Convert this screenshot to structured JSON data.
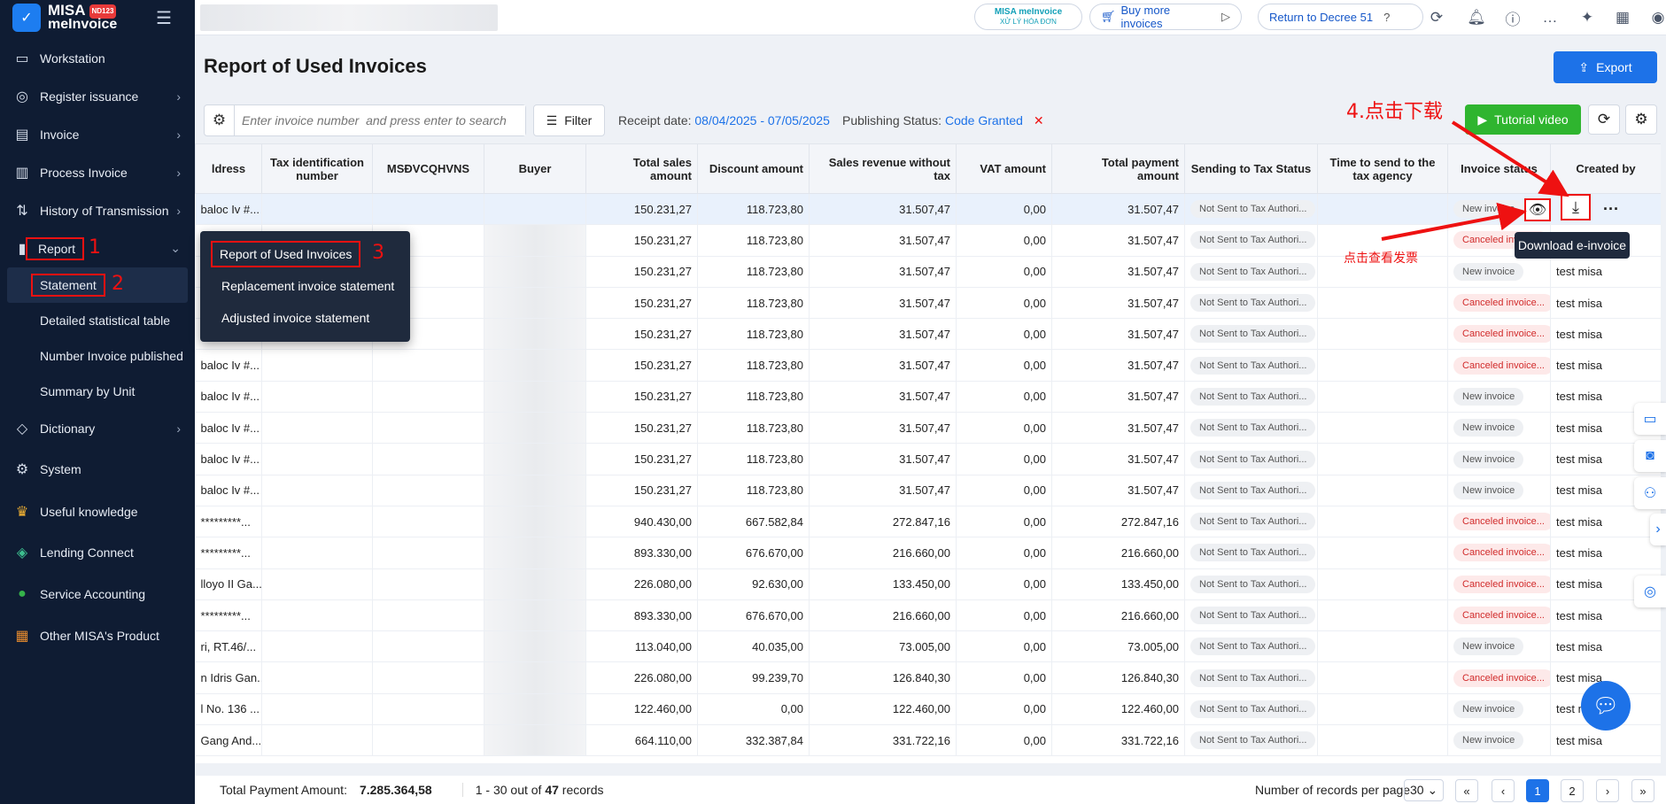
{
  "brand": {
    "name_line1": "MISA",
    "name_line2": "meInvoice",
    "badge": "ND123"
  },
  "sidebar": {
    "items": [
      {
        "label": "Workstation"
      },
      {
        "label": "Register issuance"
      },
      {
        "label": "Invoice"
      },
      {
        "label": "Process Invoice"
      },
      {
        "label": "History of Transmission"
      },
      {
        "label": "Report"
      },
      {
        "label": "Dictionary"
      },
      {
        "label": "System"
      },
      {
        "label": "Useful knowledge"
      },
      {
        "label": "Lending Connect"
      },
      {
        "label": "Service Accounting"
      },
      {
        "label": "Other MISA's Product"
      }
    ],
    "report_sub": [
      {
        "label": "Statement"
      },
      {
        "label": "Detailed statistical table"
      },
      {
        "label": "Number Invoice published"
      },
      {
        "label": "Summary by Unit"
      }
    ]
  },
  "submenu": {
    "items": [
      {
        "label": "Report of Used Invoices"
      },
      {
        "label": "Replacement invoice statement"
      },
      {
        "label": "Adjusted invoice statement"
      }
    ]
  },
  "topbar": {
    "misa_badge": "MISA meInvoice",
    "misa_sub": "XỬ LÝ HÓA ĐƠN",
    "buy_more": "Buy more invoices",
    "return_decree": "Return to Decree 51"
  },
  "page": {
    "title": "Report of Used Invoices",
    "export_label": "Export",
    "search_placeholder": "Enter invoice number  and press enter to search",
    "filter_label": "Filter",
    "receipt_label": "Receipt date:",
    "receipt_value": "08/04/2025 - 07/05/2025",
    "publishing_label": "Publishing Status:",
    "publishing_value": "Code Granted",
    "tutorial_label": "Tutorial video"
  },
  "annotations": {
    "n1": "1",
    "n2": "2",
    "n3": "3",
    "step4": "4.点击下载",
    "view_hint": "点击查看发票",
    "tooltip": "Download e-invoice"
  },
  "table": {
    "headers": [
      "ldress",
      "Tax identification number",
      "MSĐVCQHVNS",
      "Buyer",
      "Total sales amount",
      "Discount amount",
      "Sales revenue without tax",
      "VAT amount",
      "Total payment amount",
      "Sending to Tax Status",
      "Time to send to the tax agency",
      "Invoice status",
      "Created by"
    ],
    "rows": [
      {
        "addr": "baloc Iv #...",
        "total": "150.231,27",
        "disc": "118.723,80",
        "rev": "31.507,47",
        "vat": "0,00",
        "pay": "31.507,47",
        "send": "Not Sent to Tax Authori...",
        "status": "New invoice",
        "st": "grey",
        "by": ""
      },
      {
        "addr": "baloc Iv #...",
        "total": "150.231,27",
        "disc": "118.723,80",
        "rev": "31.507,47",
        "vat": "0,00",
        "pay": "31.507,47",
        "send": "Not Sent to Tax Authori...",
        "status": "Canceled invoic...",
        "st": "red",
        "by": ""
      },
      {
        "addr": "baloc Iv #...",
        "total": "150.231,27",
        "disc": "118.723,80",
        "rev": "31.507,47",
        "vat": "0,00",
        "pay": "31.507,47",
        "send": "Not Sent to Tax Authori...",
        "status": "New invoice",
        "st": "grey",
        "by": "test misa"
      },
      {
        "addr": "baloc Iv #...",
        "total": "150.231,27",
        "disc": "118.723,80",
        "rev": "31.507,47",
        "vat": "0,00",
        "pay": "31.507,47",
        "send": "Not Sent to Tax Authori...",
        "status": "Canceled invoice...",
        "st": "red",
        "by": "test misa"
      },
      {
        "addr": "baloc Iv #...",
        "total": "150.231,27",
        "disc": "118.723,80",
        "rev": "31.507,47",
        "vat": "0,00",
        "pay": "31.507,47",
        "send": "Not Sent to Tax Authori...",
        "status": "Canceled invoice...",
        "st": "red",
        "by": "test misa"
      },
      {
        "addr": "baloc Iv #...",
        "total": "150.231,27",
        "disc": "118.723,80",
        "rev": "31.507,47",
        "vat": "0,00",
        "pay": "31.507,47",
        "send": "Not Sent to Tax Authori...",
        "status": "Canceled invoice...",
        "st": "red",
        "by": "test misa"
      },
      {
        "addr": "baloc Iv #...",
        "total": "150.231,27",
        "disc": "118.723,80",
        "rev": "31.507,47",
        "vat": "0,00",
        "pay": "31.507,47",
        "send": "Not Sent to Tax Authori...",
        "status": "New invoice",
        "st": "grey",
        "by": "test misa"
      },
      {
        "addr": "baloc Iv #...",
        "total": "150.231,27",
        "disc": "118.723,80",
        "rev": "31.507,47",
        "vat": "0,00",
        "pay": "31.507,47",
        "send": "Not Sent to Tax Authori...",
        "status": "New invoice",
        "st": "grey",
        "by": "test misa"
      },
      {
        "addr": "baloc Iv #...",
        "total": "150.231,27",
        "disc": "118.723,80",
        "rev": "31.507,47",
        "vat": "0,00",
        "pay": "31.507,47",
        "send": "Not Sent to Tax Authori...",
        "status": "New invoice",
        "st": "grey",
        "by": "test misa"
      },
      {
        "addr": "baloc Iv #...",
        "total": "150.231,27",
        "disc": "118.723,80",
        "rev": "31.507,47",
        "vat": "0,00",
        "pay": "31.507,47",
        "send": "Not Sent to Tax Authori...",
        "status": "New invoice",
        "st": "grey",
        "by": "test misa"
      },
      {
        "addr": "*********...",
        "total": "940.430,00",
        "disc": "667.582,84",
        "rev": "272.847,16",
        "vat": "0,00",
        "pay": "272.847,16",
        "send": "Not Sent to Tax Authori...",
        "status": "Canceled invoice...",
        "st": "red",
        "by": "test misa"
      },
      {
        "addr": "*********...",
        "total": "893.330,00",
        "disc": "676.670,00",
        "rev": "216.660,00",
        "vat": "0,00",
        "pay": "216.660,00",
        "send": "Not Sent to Tax Authori...",
        "status": "Canceled invoice...",
        "st": "red",
        "by": "test misa"
      },
      {
        "addr": "lloyo II Ga...",
        "total": "226.080,00",
        "disc": "92.630,00",
        "rev": "133.450,00",
        "vat": "0,00",
        "pay": "133.450,00",
        "send": "Not Sent to Tax Authori...",
        "status": "Canceled invoice...",
        "st": "red",
        "by": "test misa"
      },
      {
        "addr": "*********...",
        "total": "893.330,00",
        "disc": "676.670,00",
        "rev": "216.660,00",
        "vat": "0,00",
        "pay": "216.660,00",
        "send": "Not Sent to Tax Authori...",
        "status": "Canceled invoice...",
        "st": "red",
        "by": "test misa"
      },
      {
        "addr": "ri, RT.46/...",
        "total": "113.040,00",
        "disc": "40.035,00",
        "rev": "73.005,00",
        "vat": "0,00",
        "pay": "73.005,00",
        "send": "Not Sent to Tax Authori...",
        "status": "New invoice",
        "st": "grey",
        "by": "test misa"
      },
      {
        "addr": "n Idris Gan...",
        "total": "226.080,00",
        "disc": "99.239,70",
        "rev": "126.840,30",
        "vat": "0,00",
        "pay": "126.840,30",
        "send": "Not Sent to Tax Authori...",
        "status": "Canceled invoice...",
        "st": "red",
        "by": "test misa"
      },
      {
        "addr": "l No. 136 ...",
        "total": "122.460,00",
        "disc": "0,00",
        "rev": "122.460,00",
        "vat": "0,00",
        "pay": "122.460,00",
        "send": "Not Sent to Tax Authori...",
        "status": "New invoice",
        "st": "grey",
        "by": "test mi"
      },
      {
        "addr": "Gang And...",
        "total": "664.110,00",
        "disc": "332.387,84",
        "rev": "331.722,16",
        "vat": "0,00",
        "pay": "331.722,16",
        "send": "Not Sent to Tax Authori...",
        "status": "New invoice",
        "st": "grey",
        "by": "test misa"
      }
    ]
  },
  "footer": {
    "total_label": "Total Payment Amount:",
    "total_value": "7.285.364,58",
    "records_text_pre": "1 - 30 out of",
    "records_total": "47",
    "records_text_post": "records",
    "per_page_label": "Number of records per page",
    "per_page_value": "30",
    "pages": [
      "1",
      "2"
    ]
  }
}
